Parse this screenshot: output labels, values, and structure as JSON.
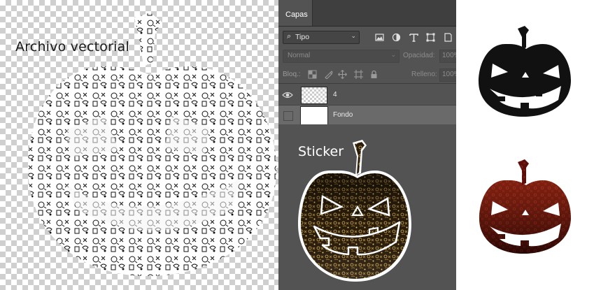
{
  "left_canvas": {
    "label": "Archivo vectorial"
  },
  "layers_panel": {
    "tab_label": "Capas",
    "filter": {
      "kind_label": "Tipo",
      "icons": [
        "image-filter-icon",
        "adjustment-filter-icon",
        "type-filter-icon",
        "shape-filter-icon",
        "smart-object-filter-icon"
      ]
    },
    "blend_mode": "Normal",
    "opacity_label": "Opacidad:",
    "opacity_value": "100%",
    "lock_label": "Bloq.:",
    "lock_icons": [
      "lock-transparent-pixels-icon",
      "lock-image-pixels-icon",
      "lock-position-icon",
      "lock-artboard-icon",
      "lock-all-icon"
    ],
    "fill_label": "Relleno:",
    "fill_value": "100%",
    "layers": [
      {
        "name": "4",
        "visible": true,
        "thumbnail": "transparent-pattern"
      },
      {
        "name": "Fondo",
        "visible": false,
        "thumbnail": "white",
        "selected": true
      }
    ]
  },
  "sticker_preview": {
    "label": "Sticker",
    "colors": {
      "fill_dark": "#2b1d0c",
      "fill_gold": "#c9a24a",
      "outline": "#ffffff"
    }
  },
  "right_pumpkins": [
    {
      "style": "solid-black",
      "fill": "#111111"
    },
    {
      "style": "red-pattern",
      "fill": "#8a1a10"
    }
  ]
}
